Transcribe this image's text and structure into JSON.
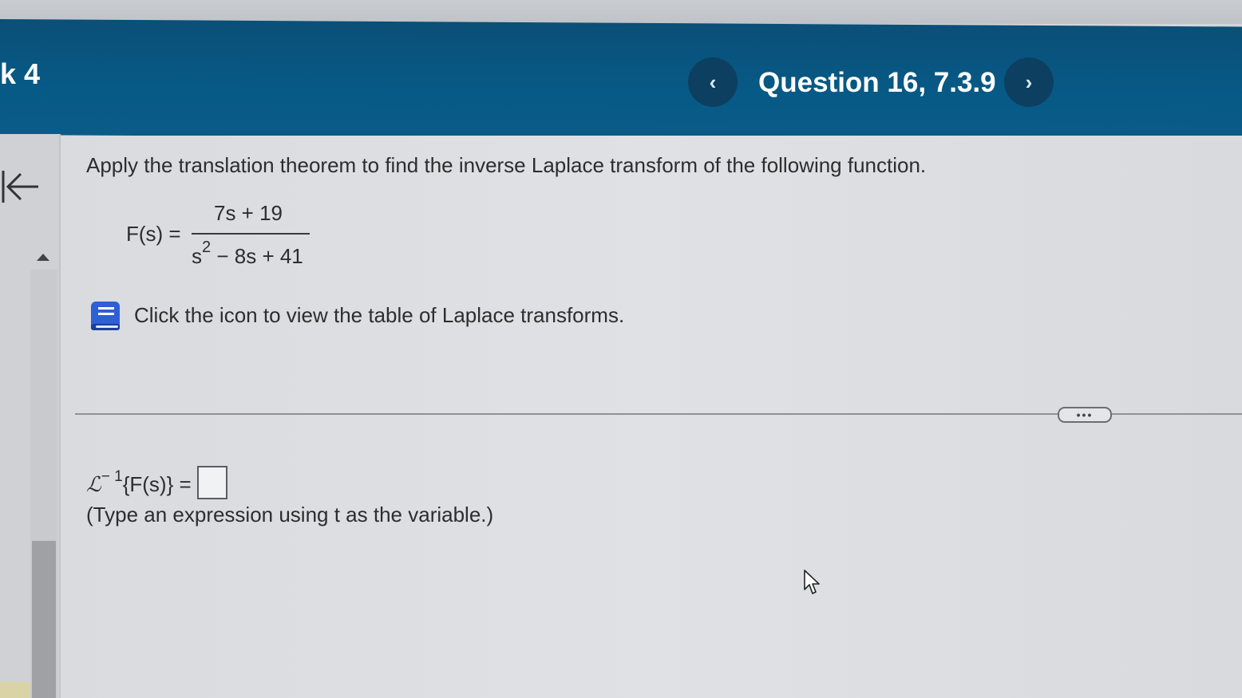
{
  "header": {
    "assignment_fragment": "k 4",
    "question_label": "Question 16, 7.3.9",
    "prev_glyph": "‹",
    "next_glyph": "›"
  },
  "problem": {
    "instruction": "Apply the translation theorem to find the inverse Laplace transform of the following function.",
    "function_lhs": "F(s) =",
    "numerator": "7s + 19",
    "denominator_base": "s",
    "denominator_exp": "2",
    "denominator_rest": " − 8s + 41"
  },
  "table_link": {
    "icon": "book-icon",
    "text": "Click the icon to view the table of Laplace transforms."
  },
  "more_button": {
    "label": "•••"
  },
  "answer": {
    "operator": "ℒ",
    "inverse_exp": "− 1",
    "expression": "{F(s)} =",
    "value": "",
    "hint": "(Type an expression using t as the variable.)"
  },
  "colors": {
    "header_blue": "#075a86",
    "nav_button": "#0d3f61",
    "book_blue": "#2f5fd6"
  }
}
